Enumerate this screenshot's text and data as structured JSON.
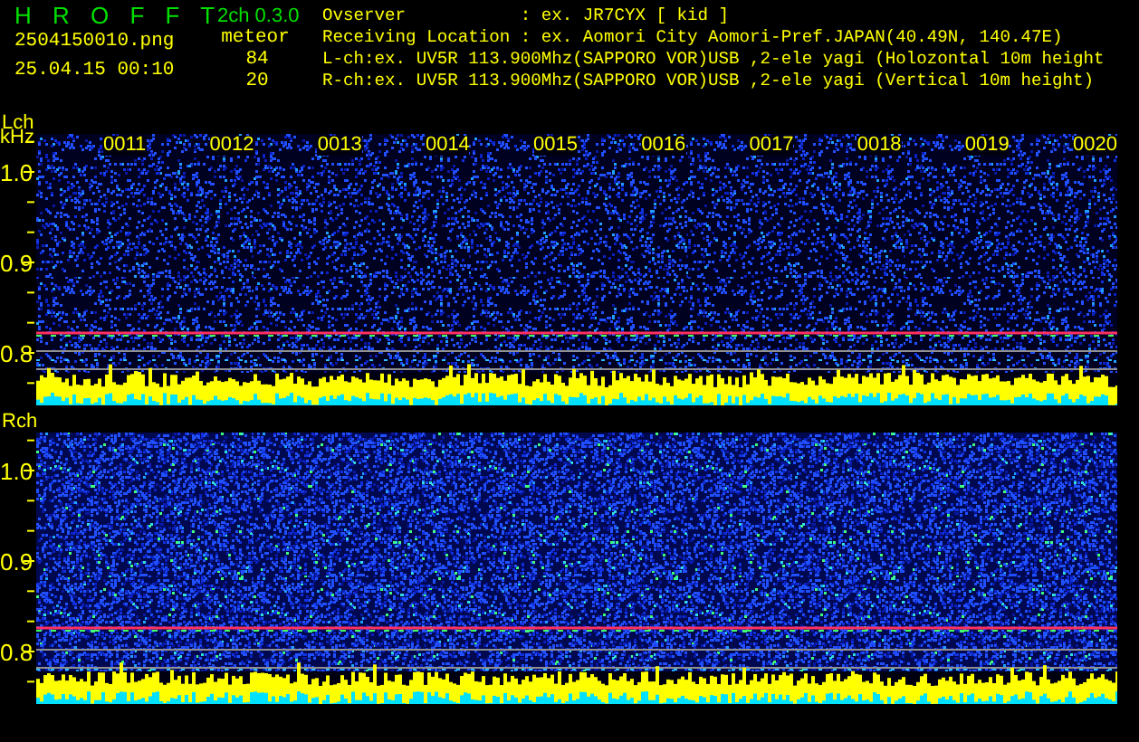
{
  "header": {
    "title": "H R O F F T",
    "version": "2ch 0.3.0",
    "file_name": "2504150010.png",
    "date_time": "25.04.15 00:10",
    "meteor_label": "meteor",
    "counts": [
      "84",
      "20"
    ],
    "info_lines": [
      "Ovserver           : ex. JR7CYX [ kid ]",
      "Receiving Location : ex. Aomori City Aomori-Pref.JAPAN(40.49N, 140.47E)",
      "L-ch:ex. UV5R 113.900Mhz(SAPPORO VOR)USB ,2-ele yagi (Holozontal 10m height",
      "R-ch:ex. UV5R 113.900Mhz(SAPPORO VOR)USB ,2-ele yagi (Vertical 10m height)"
    ]
  },
  "channels": [
    {
      "label": "Lch",
      "unit": "kHz",
      "times": [
        "0011",
        "0012",
        "0013",
        "0014",
        "0015",
        "0016",
        "0017",
        "0018",
        "0019",
        "0020"
      ],
      "yticks": [
        "1.0",
        "0.9",
        "0.8"
      ]
    },
    {
      "label": "Rch",
      "yticks": [
        "1.0",
        "0.9",
        "0.8"
      ]
    }
  ]
}
